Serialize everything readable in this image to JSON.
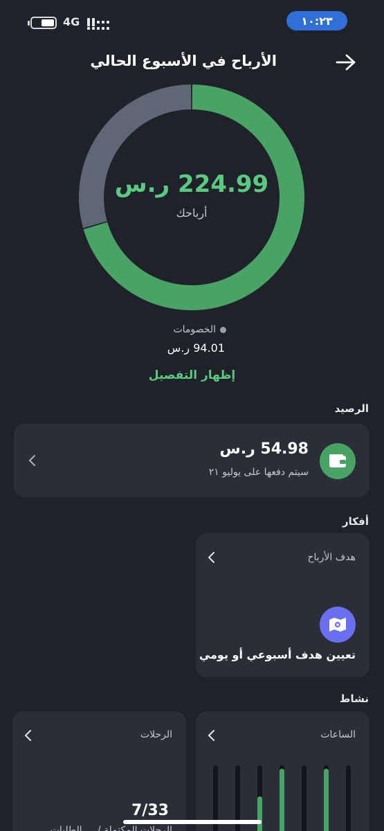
{
  "status_bar": {
    "time": "١٠:٢٣",
    "network": "4G"
  },
  "header": {
    "title": "الأرباح في الأسبوع الحالي"
  },
  "earnings": {
    "amount": "224.99 ر.س",
    "caption": "أرباحك"
  },
  "chart_data": {
    "type": "pie",
    "categories": [
      "أرباحك",
      "الخصومات"
    ],
    "values": [
      224.99,
      94.01
    ],
    "colors": [
      "#4aa366",
      "#5f6675"
    ]
  },
  "deductions": {
    "label": "الخصومات",
    "value": "94.01 ر.س"
  },
  "show_details_label": "إظهار التفصيل",
  "balance": {
    "section_title": "الرصيد",
    "amount": "54.98 ر.س",
    "subtitle": "سيتم دفعها على يوليو ٢١"
  },
  "ideas": {
    "section_title": "أفكار",
    "card_title": "هدف الأرباح",
    "action": "تعيين هدف أسبوعي أو يومي"
  },
  "activity": {
    "section_title": "نشاط",
    "hours_title": "الساعات",
    "hours_bars": [
      0.0,
      0.05,
      0.55,
      0.95,
      0.0,
      0.95,
      0.0
    ],
    "trips_title": "الرحلات",
    "trips_subtitle": "الرحلات المكتملة / ...  الطلبات"
  },
  "page_counter": "7/33",
  "colors": {
    "background": "#1f2329",
    "card": "#2a2f37",
    "accent_green": "#4aa366",
    "text_green": "#5cc983",
    "deductions_gray": "#5f6675",
    "time_pill": "#2f6fd6",
    "goal_icon": "#6a6ff0"
  }
}
